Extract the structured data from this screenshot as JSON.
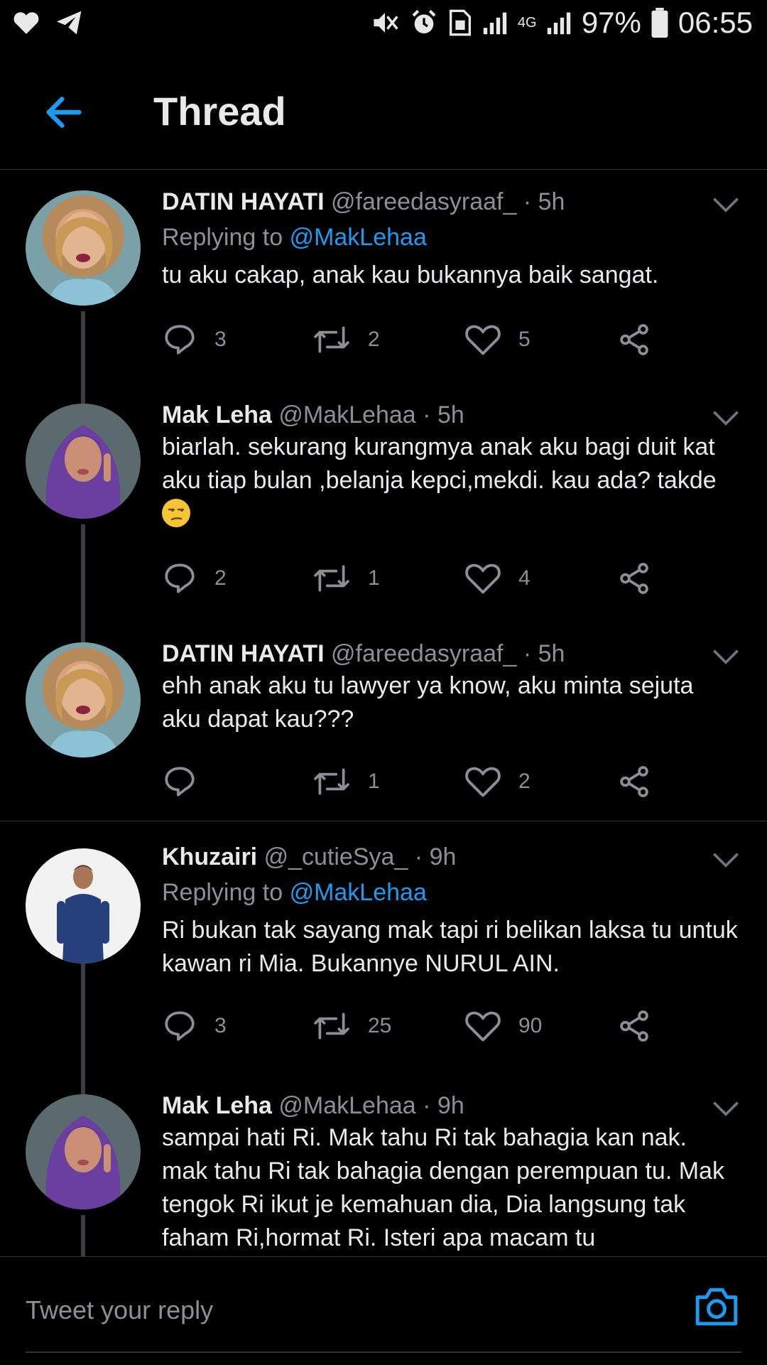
{
  "status_bar": {
    "battery": "97%",
    "time": "06:55",
    "network": "4G"
  },
  "header": {
    "title": "Thread"
  },
  "tweets": [
    {
      "name": "DATIN HAYATI",
      "handle": "@fareedasyraaf_",
      "time": "5h",
      "replying_label": "Replying to",
      "replying_to": "@MakLehaa",
      "text": "tu aku cakap, anak kau bukannya baik sangat.",
      "replies": "3",
      "retweets": "2",
      "likes": "5"
    },
    {
      "name": "Mak Leha",
      "handle": "@MakLehaa",
      "time": "5h",
      "text": "biarlah. sekurang kurangmya anak aku bagi duit kat aku tiap bulan ,belanja kepci,mekdi. kau ada? takde",
      "emoji": "unamused-face",
      "replies": "2",
      "retweets": "1",
      "likes": "4"
    },
    {
      "name": "DATIN HAYATI",
      "handle": "@fareedasyraaf_",
      "time": "5h",
      "text": "ehh anak aku tu lawyer ya know, aku minta sejuta aku dapat kau???",
      "replies": "",
      "retweets": "1",
      "likes": "2"
    },
    {
      "name": "Khuzairi",
      "handle": "@_cutieSya_",
      "time": "9h",
      "replying_label": "Replying to",
      "replying_to": "@MakLehaa",
      "text": "Ri bukan tak sayang mak tapi ri belikan laksa tu untuk kawan ri Mia. Bukannye NURUL AIN.",
      "replies": "3",
      "retweets": "25",
      "likes": "90"
    },
    {
      "name": "Mak Leha",
      "handle": "@MakLehaa",
      "time": "9h",
      "text": "sampai hati Ri. Mak tahu Ri tak bahagia kan nak. mak tahu Ri tak bahagia dengan perempuan tu. Mak tengok Ri ikut je kemahuan dia, Dia langsung tak faham Ri,hormat Ri. Isteri apa macam tu"
    }
  ],
  "reply_box": {
    "placeholder": "Tweet your reply"
  },
  "colors": {
    "accent": "#1d9bf0",
    "muted": "#8b9096",
    "background": "#000000"
  }
}
